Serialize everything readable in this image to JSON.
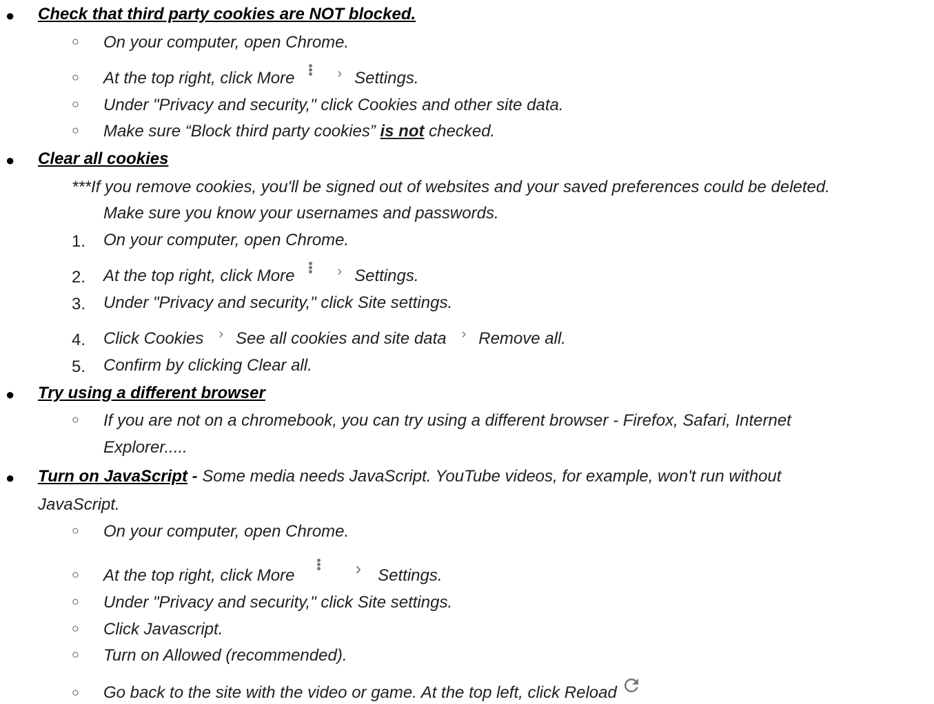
{
  "s1": {
    "heading": "Check that third party cookies are NOT blocked.",
    "i1": "On your computer, open Chrome.",
    "i2a": "At the top right, click More",
    "i2b": "Settings.",
    "i3": "Under \"Privacy and security,\" click Cookies and other site data.",
    "i4a": "Make sure “Block third party cookies”",
    "i4b": "is not",
    "i4c": "checked."
  },
  "s2": {
    "heading": "Clear all cookies",
    "note1": "***If you remove cookies, you'll be signed out of websites and your saved preferences could be deleted.",
    "note2": "Make sure you know your usernames and passwords.",
    "n1": "1.",
    "i1": "On your computer, open Chrome.",
    "n2": "2.",
    "i2a": "At the top right, click More",
    "i2b": "Settings.",
    "n3": "3.",
    "i3": "Under \"Privacy and security,\" click Site settings.",
    "n4": "4.",
    "i4a": "Click Cookies",
    "i4b": "See all cookies and site data",
    "i4c": "Remove all.",
    "n5": "5.",
    "i5": "Confirm by clicking Clear all."
  },
  "s3": {
    "heading": "Try using a different browser",
    "i1a": "If you are not on a chromebook, you can try using a different browser - Firefox, Safari, Internet",
    "i1b": "Explorer....."
  },
  "s4": {
    "heading": "Turn on JavaScript",
    "sep": " - ",
    "desc": "Some media needs JavaScript. YouTube videos, for example, won't run without",
    "desc2": "JavaScript.",
    "i1": "On your computer, open Chrome.",
    "i2a": "At the top right, click More",
    "i2b": "Settings.",
    "i3": "Under \"Privacy and security,\" click Site settings.",
    "i4": "Click Javascript.",
    "i5": "Turn on Allowed (recommended).",
    "i6": "Go back to the site with the video or game. At the top left, click Reload"
  },
  "glyphs": {
    "bullet": "●",
    "subbullet": "○",
    "chevron": "›"
  },
  "icons": [
    "more-vert-icon",
    "chevron-right-icon",
    "reload-icon"
  ]
}
